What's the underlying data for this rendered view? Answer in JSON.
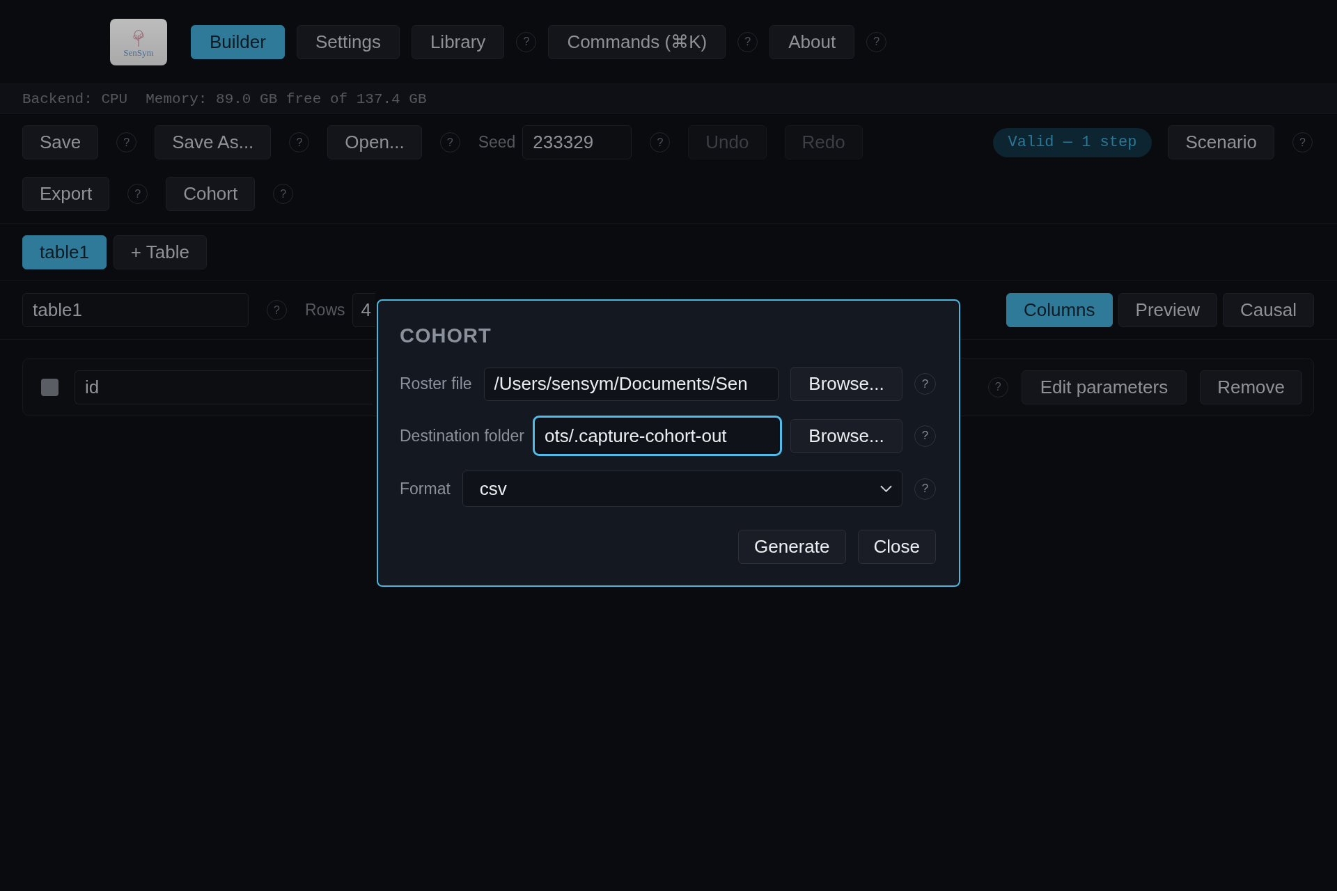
{
  "logo": {
    "text": "SenSym"
  },
  "nav": [
    {
      "label": "Builder",
      "selected": true
    },
    {
      "label": "Settings",
      "selected": false
    },
    {
      "label": "Library",
      "selected": false,
      "help": "?"
    },
    {
      "label": "Commands (⌘K)",
      "selected": false,
      "help": "?"
    },
    {
      "label": "About",
      "selected": false,
      "help": "?"
    }
  ],
  "status_bar": {
    "backend": "Backend: CPU",
    "memory": "Memory: 89.0 GB free of 137.4 GB"
  },
  "toolbar": {
    "rows": [
      {
        "left": [
          {
            "kind": "button",
            "label": "Save",
            "disabled": false,
            "help": "?"
          },
          {
            "kind": "button",
            "label": "Save As...",
            "disabled": false,
            "help": "?"
          },
          {
            "kind": "button",
            "label": "Open...",
            "disabled": false,
            "help": "?"
          },
          {
            "kind": "field",
            "label": "Seed",
            "value": "233329",
            "help": "?"
          },
          {
            "kind": "button",
            "label": "Undo",
            "disabled": true
          },
          {
            "kind": "button",
            "label": "Redo",
            "disabled": true
          }
        ],
        "right": [
          {
            "kind": "badge",
            "label": "Valid — 1 step"
          },
          {
            "kind": "button",
            "label": "Scenario",
            "disabled": false,
            "help": "?"
          }
        ]
      },
      {
        "left": [
          {
            "kind": "button",
            "label": "Export",
            "disabled": false,
            "help": "?"
          },
          {
            "kind": "button",
            "label": "Cohort",
            "disabled": false,
            "help": "?"
          }
        ]
      }
    ]
  },
  "table_tabs": {
    "tabs": [
      {
        "label": "table1",
        "selected": true
      }
    ],
    "add_button": "+ Table"
  },
  "table_settings": {
    "name": "table1",
    "name_help": "?",
    "rows_label": "Rows",
    "rows_value": "4"
  },
  "view_tabs": [
    {
      "label": "Columns",
      "selected": true
    },
    {
      "label": "Preview",
      "selected": false
    },
    {
      "label": "Causal",
      "selected": false
    }
  ],
  "columns": [
    {
      "checked": false,
      "name": "id",
      "help": "?",
      "edit_button": "Edit parameters",
      "remove_button": "Remove"
    }
  ],
  "dialog": {
    "title": "COHORT",
    "fields": [
      {
        "kind": "path",
        "label": "Roster file",
        "value": "/Users/sensym/Documents/Sen",
        "focused": false,
        "browse": "Browse...",
        "help": "?"
      },
      {
        "kind": "path",
        "label": "Destination folder",
        "value": "ots/.capture-cohort-out",
        "focused": true,
        "browse": "Browse...",
        "help": "?"
      },
      {
        "kind": "select",
        "label": "Format",
        "value": "csv",
        "help": "?"
      }
    ],
    "buttons": [
      "Generate",
      "Close"
    ]
  }
}
